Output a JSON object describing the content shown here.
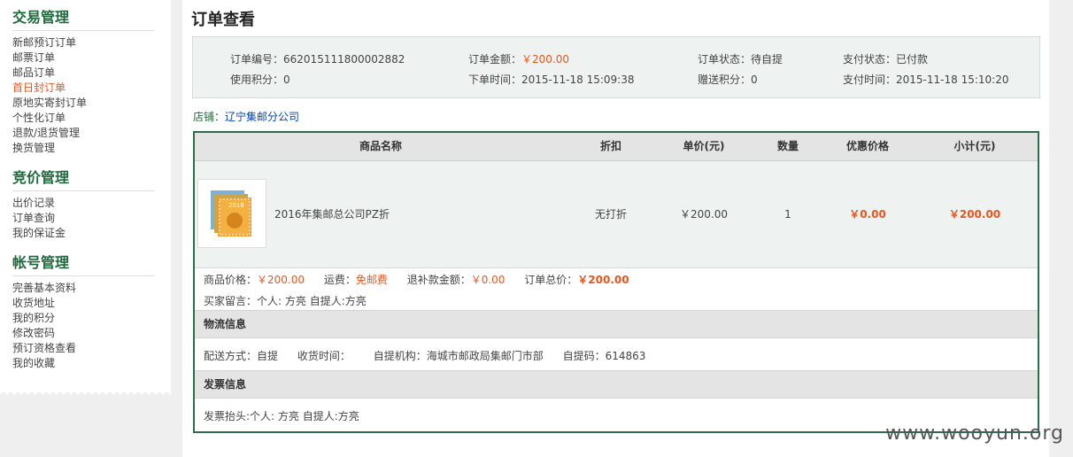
{
  "sidebar": {
    "sections": [
      {
        "title": "交易管理",
        "items": [
          "新邮预订订单",
          "邮票订单",
          "邮品订单",
          "首日封订单",
          "原地实寄封订单",
          "个性化订单",
          "退款/退货管理",
          "换货管理"
        ]
      },
      {
        "title": "竞价管理",
        "items": [
          "出价记录",
          "订单查询",
          "我的保证金"
        ]
      },
      {
        "title": "帐号管理",
        "items": [
          "完善基本资料",
          "收货地址",
          "我的积分",
          "修改密码",
          "预订资格查看",
          "我的收藏"
        ]
      }
    ],
    "active_item": "首日封订单"
  },
  "page_title": "订单查看",
  "summary": {
    "order_no_label": "订单编号：",
    "order_no": "662015111800002882",
    "amount_label": "订单金额：",
    "amount": "￥200.00",
    "status_label": "订单状态：",
    "status": "待自提",
    "pay_status_label": "支付状态：",
    "pay_status": "已付款",
    "points_used_label": "使用积分：",
    "points_used": "0",
    "order_time_label": "下单时间：",
    "order_time": "2015-11-18 15:09:38",
    "points_gift_label": "赠送积分：",
    "points_gift": "0",
    "pay_time_label": "支付时间：",
    "pay_time": "2015-11-18 15:10:20"
  },
  "shop": {
    "label": "店铺：",
    "name": "辽宁集邮分公司"
  },
  "table": {
    "headers": [
      "商品名称",
      "折扣",
      "单价(元)",
      "数量",
      "优惠价格",
      "小计(元)"
    ],
    "row": {
      "name": "2016年集邮总公司PZ折",
      "discount": "无打折",
      "unit_price": "￥200.00",
      "qty": "1",
      "promo_price": "￥0.00",
      "subtotal": "￥200.00",
      "thumb_text": "2016"
    }
  },
  "totals": {
    "goods_label": "商品价格：",
    "goods": "￥200.00",
    "shipping_label": "运费：",
    "shipping": "免邮费",
    "refund_label": "退补款金额：",
    "refund": "￥0.00",
    "total_label": "订单总价：",
    "total": "￥200.00"
  },
  "message": {
    "label": "买家留言：",
    "text": "个人: 方亮 自提人:方亮"
  },
  "logistics": {
    "title": "物流信息",
    "method_label": "配送方式：",
    "method": "自提",
    "receive_label": "收货时间：",
    "receive": "",
    "org_label": "自提机构：",
    "org": "海城市邮政局集邮门市部",
    "code_label": "自提码：",
    "code": "614863"
  },
  "invoice": {
    "title": "发票信息",
    "label": "发票抬头:",
    "text": "个人: 方亮 自提人:方亮"
  },
  "watermark": "www.wooyun.org",
  "colors": {
    "accent": "#e8561e",
    "brand_green": "#1f6a3b",
    "border_green": "#2e6b4f",
    "link": "#0645ad"
  }
}
